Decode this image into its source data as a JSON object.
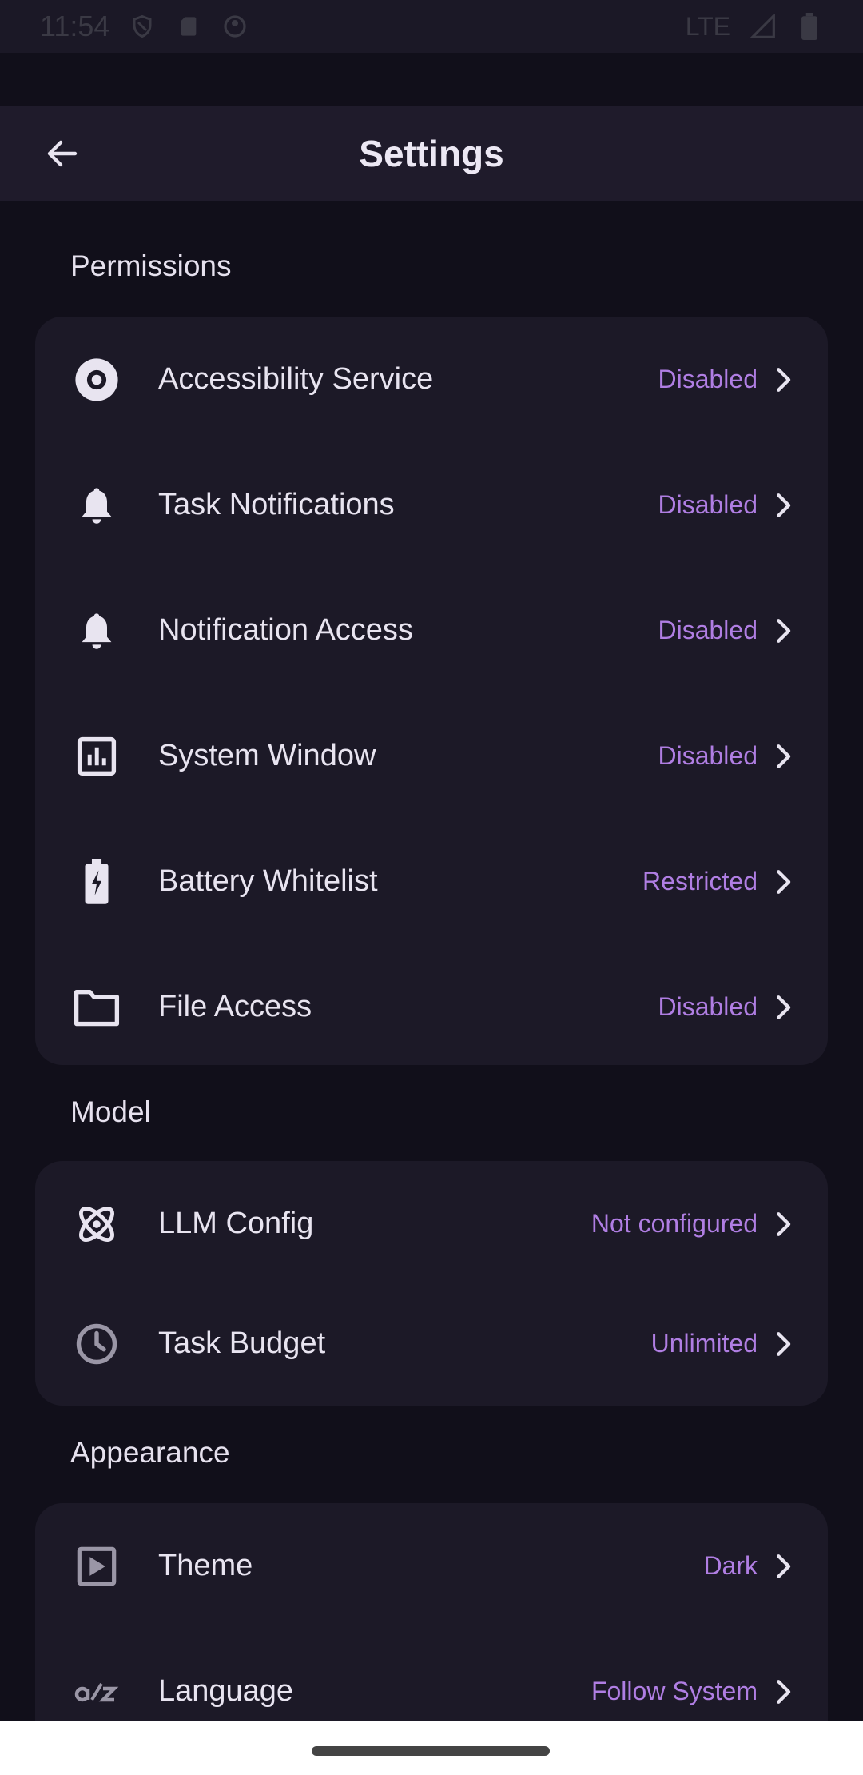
{
  "status_bar": {
    "time": "11:54",
    "network": "LTE"
  },
  "app_bar": {
    "title": "Settings",
    "back_icon": "arrow-back-icon"
  },
  "sections": {
    "permissions": {
      "title": "Permissions",
      "items": [
        {
          "label": "Accessibility Service",
          "value": "Disabled",
          "icon": "accessibility-icon"
        },
        {
          "label": "Task Notifications",
          "value": "Disabled",
          "icon": "bell-icon"
        },
        {
          "label": "Notification Access",
          "value": "Disabled",
          "icon": "bell-icon"
        },
        {
          "label": "System Window",
          "value": "Disabled",
          "icon": "bar-chart-icon"
        },
        {
          "label": "Battery Whitelist",
          "value": "Restricted",
          "icon": "battery-charging-icon"
        },
        {
          "label": "File Access",
          "value": "Disabled",
          "icon": "folder-icon"
        }
      ]
    },
    "model": {
      "title": "Model",
      "items": [
        {
          "label": "LLM Config",
          "value": "Not configured",
          "icon": "atom-icon"
        },
        {
          "label": "Task Budget",
          "value": "Unlimited",
          "icon": "clock-icon"
        }
      ]
    },
    "appearance": {
      "title": "Appearance",
      "items": [
        {
          "label": "Theme",
          "value": "Dark",
          "icon": "theme-play-icon"
        },
        {
          "label": "Language",
          "value": "Follow System",
          "icon": "translate-az-icon"
        }
      ]
    }
  },
  "colors": {
    "background": "#110f1a",
    "card": "#1c1927",
    "app_bar": "#1f1b2b",
    "accent": "#b07ee3",
    "text": "#e8e4f0"
  }
}
